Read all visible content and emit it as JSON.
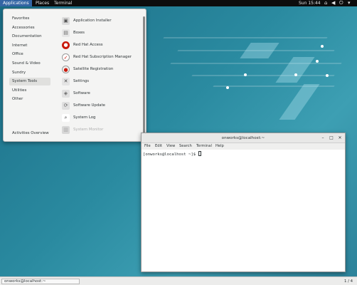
{
  "topbar": {
    "menus": [
      "Applications",
      "Places",
      "Terminal"
    ],
    "active_menu": "Applications",
    "clock": "Sun 15:44",
    "tray_icons": [
      "network-icon",
      "volume-icon",
      "power-icon",
      "chevron-down-icon"
    ]
  },
  "app_menu": {
    "categories": [
      "Favorites",
      "Accessories",
      "Documentation",
      "Internet",
      "Office",
      "Sound & Video",
      "Sundry",
      "System Tools",
      "Utilities",
      "Other"
    ],
    "hovered_category": "System Tools",
    "activities_overview": "Activities Overview",
    "apps": [
      {
        "label": "Application Installer",
        "icon": "installer-icon"
      },
      {
        "label": "Boxes",
        "icon": "boxes-icon"
      },
      {
        "label": "Red Hat Access",
        "icon": "redhat-icon"
      },
      {
        "label": "Red Hat Subscription Manager",
        "icon": "subscription-icon"
      },
      {
        "label": "Satellite Registration",
        "icon": "satellite-icon"
      },
      {
        "label": "Settings",
        "icon": "settings-icon"
      },
      {
        "label": "Software",
        "icon": "software-icon"
      },
      {
        "label": "Software Update",
        "icon": "update-icon"
      },
      {
        "label": "System Log",
        "icon": "log-icon"
      },
      {
        "label": "System Monitor",
        "icon": "monitor-icon"
      }
    ]
  },
  "terminal": {
    "title": "onworks@localhost:~",
    "menu": [
      "File",
      "Edit",
      "View",
      "Search",
      "Terminal",
      "Help"
    ],
    "prompt": "[onworks@localhost ~]$ "
  },
  "bottombar": {
    "task_label": "onworks@localhost:~",
    "workspace": "1 / 4"
  }
}
